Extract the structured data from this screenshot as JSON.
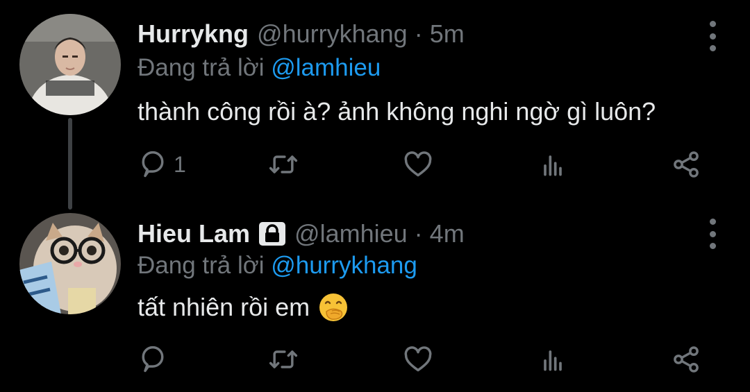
{
  "tweets": [
    {
      "name": "Hurrykng",
      "handle": "@hurrykhang",
      "separator": "·",
      "time": "5m",
      "replying_prefix": "Đang trả lời",
      "replying_to": "@lamhieu",
      "text": "thành công rồi à? ảnh không nghi ngờ gì luôn?",
      "reply_count": "1",
      "icons": [
        "reply-icon",
        "retweet-icon",
        "like-icon",
        "stats-icon",
        "share-icon",
        "more-icon"
      ]
    },
    {
      "name": "Hieu Lam",
      "handle": "@lamhieu",
      "separator": "·",
      "time": "4m",
      "replying_prefix": "Đang trả lời",
      "replying_to": "@hurrykhang",
      "text": "tất nhiên rồi em",
      "protected": true,
      "emoji": "face-with-hand-over-mouth",
      "reply_count": "",
      "icons": [
        "lock-icon",
        "reply-icon",
        "retweet-icon",
        "like-icon",
        "stats-icon",
        "share-icon",
        "more-icon"
      ]
    }
  ],
  "colors": {
    "background": "#000000",
    "primary_text": "#e7e9ea",
    "secondary_text": "#71767b",
    "accent": "#1d9bf0",
    "thread_line": "#3e4144"
  }
}
